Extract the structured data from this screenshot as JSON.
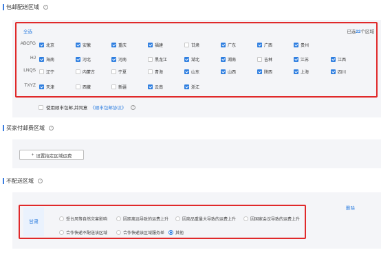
{
  "free_shipping": {
    "title": "包邮配送区域",
    "select_all": "全选",
    "count_prefix": "已选",
    "count_value": "22",
    "count_suffix": "个区域",
    "rows": [
      {
        "label": "ABCFG",
        "items": [
          {
            "name": "北京",
            "checked": true
          },
          {
            "name": "安徽",
            "checked": true
          },
          {
            "name": "重庆",
            "checked": true
          },
          {
            "name": "福建",
            "checked": true
          },
          {
            "name": "甘肃",
            "checked": false
          },
          {
            "name": "广东",
            "checked": true
          },
          {
            "name": "广西",
            "checked": true
          },
          {
            "name": "贵州",
            "checked": true
          }
        ]
      },
      {
        "label": "HJ",
        "items": [
          {
            "name": "海南",
            "checked": true
          },
          {
            "name": "河北",
            "checked": true
          },
          {
            "name": "河南",
            "checked": true
          },
          {
            "name": "黑龙江",
            "checked": false
          },
          {
            "name": "湖北",
            "checked": true
          },
          {
            "name": "湖南",
            "checked": true
          },
          {
            "name": "吉林",
            "checked": false
          },
          {
            "name": "江苏",
            "checked": true
          },
          {
            "name": "江西",
            "checked": true
          }
        ]
      },
      {
        "label": "LNQS",
        "items": [
          {
            "name": "辽宁",
            "checked": false
          },
          {
            "name": "内蒙古",
            "checked": false
          },
          {
            "name": "宁夏",
            "checked": false
          },
          {
            "name": "青海",
            "checked": false
          },
          {
            "name": "山东",
            "checked": true
          },
          {
            "name": "山西",
            "checked": true
          },
          {
            "name": "陕西",
            "checked": true
          },
          {
            "name": "上海",
            "checked": true
          },
          {
            "name": "四川",
            "checked": true
          }
        ]
      },
      {
        "label": "TXYZ",
        "items": [
          {
            "name": "天津",
            "checked": true
          },
          {
            "name": "西藏",
            "checked": false
          },
          {
            "name": "新疆",
            "checked": false
          },
          {
            "name": "云南",
            "checked": true
          },
          {
            "name": "浙江",
            "checked": true
          }
        ]
      }
    ],
    "agree_text": "使用顺丰包邮,并同意",
    "agree_link": "《顺丰包邮协议》",
    "agree_checked": false
  },
  "paid_shipping": {
    "title": "买家付邮费区域",
    "button_label": "设置指定区域运费",
    "button_icon": "+"
  },
  "no_shipping": {
    "title": "不配送区域",
    "province": "甘肃",
    "delete_label": "删除",
    "reasons": [
      {
        "label": "受台风等自然灾害影响",
        "selected": false
      },
      {
        "label": "因距离远导致的运费上升",
        "selected": false
      },
      {
        "label": "因商品重量大导致的运费上升",
        "selected": false
      },
      {
        "label": "因国家会议导致的运费上升",
        "selected": false
      },
      {
        "label": "合作快递不配送该区域",
        "selected": false
      },
      {
        "label": "合作快递该区域服务差",
        "selected": false
      },
      {
        "label": "其他",
        "selected": true
      }
    ]
  },
  "help_icon": "?",
  "colors": {
    "accent": "#2f7fe0",
    "highlight": "#e0292a",
    "panel": "#f4f5f8"
  }
}
